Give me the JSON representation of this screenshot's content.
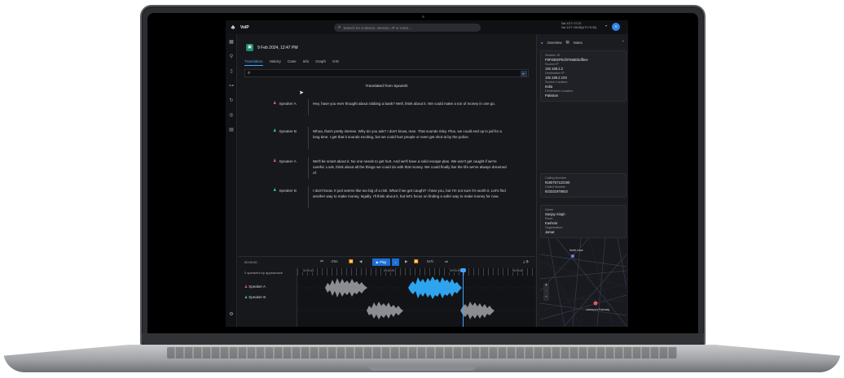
{
  "topbar": {
    "app_name": "VoIP",
    "search_placeholder": "Search for a device, session, IP or more...",
    "date_line_1": "Sat 1/27~27:22",
    "date_line_2": "Sat 1/27~08:08(UTC+5:30)",
    "avatar_initial": "A"
  },
  "case": {
    "title": "9 Feb 2024, 12:47 PM",
    "tabs": [
      "Translation",
      "History",
      "Case",
      "Info",
      "Graph",
      "GIS"
    ],
    "active_tab": "Translation"
  },
  "transcript": {
    "heading": "Translated from Spanish",
    "utterances": [
      {
        "speaker": "Speaker A",
        "color": "#e35a5a",
        "text": "Hey, have you ever thought about robbing a bank? Well, think about it. We could make a ton of money in one go."
      },
      {
        "speaker": "Speaker B",
        "color": "#2cc7a8",
        "text": "Whoa, that's pretty intense. Why do you ask? I don't know, man. That sounds risky. Plus, we could end up in jail for a long time. I get that it sounds exciting, but we could hurt people or even get shot at by the police."
      },
      {
        "speaker": "Speaker A",
        "color": "#e35a5a",
        "text": "We'll be smart about it. No one needs to get hurt. And we'll have a solid escape plan. We won't get caught if we're careful. Look, think about all the things we could do with that money. We could finally live the life we've always dreamed of."
      },
      {
        "speaker": "Speaker B",
        "color": "#2cc7a8",
        "text": "I don't know. It just seems like too big of a risk. What if we get caught? I hear you, but I'm not sure it's worth it. Let's find another way to make money, legally. I'll think about it, but let's focus on finding a safer way to make money for now."
      }
    ]
  },
  "player": {
    "current_time": "00:00:00",
    "rewind_label": "5s",
    "forward_label": "5s",
    "play_label": "Play",
    "speakers_header": "2 speakers by appearance",
    "speakers": [
      {
        "name": "Speaker A",
        "color": "#e35a5a"
      },
      {
        "name": "Speaker B",
        "color": "#2cc7a8"
      }
    ],
    "ruler_labels": [
      "00:00:10",
      "00:00:20",
      "00:00:30",
      "00:00:40"
    ]
  },
  "details": {
    "tabs": [
      "Overview",
      "Notes"
    ],
    "session": [
      {
        "label": "Session ID",
        "value": "F9F83D0Fbcf07665Ebdfbee"
      },
      {
        "label": "Source IP",
        "value": "192.168.2.2"
      },
      {
        "label": "Destination IP",
        "value": "192.168.2.103"
      },
      {
        "label": "Source Location",
        "value": "India"
      },
      {
        "label": "Destination Location",
        "value": "Pakistan"
      }
    ],
    "numbers": [
      {
        "label": "Calling Number",
        "value": "9180757122190"
      },
      {
        "label": "Called Number",
        "value": "923331979502"
      }
    ],
    "person": [
      {
        "label": "Name",
        "value": "Sanjay Singh"
      },
      {
        "label": "Place",
        "value": "Kashmir"
      },
      {
        "label": "Organization",
        "value": "Jamat"
      }
    ],
    "map_labels": [
      "North Lane",
      "Johnson's Parkway"
    ]
  },
  "colors": {
    "accent": "#1b6fd6",
    "wave_active": "#2fa4ee",
    "wave_idle": "#8b8d93"
  }
}
